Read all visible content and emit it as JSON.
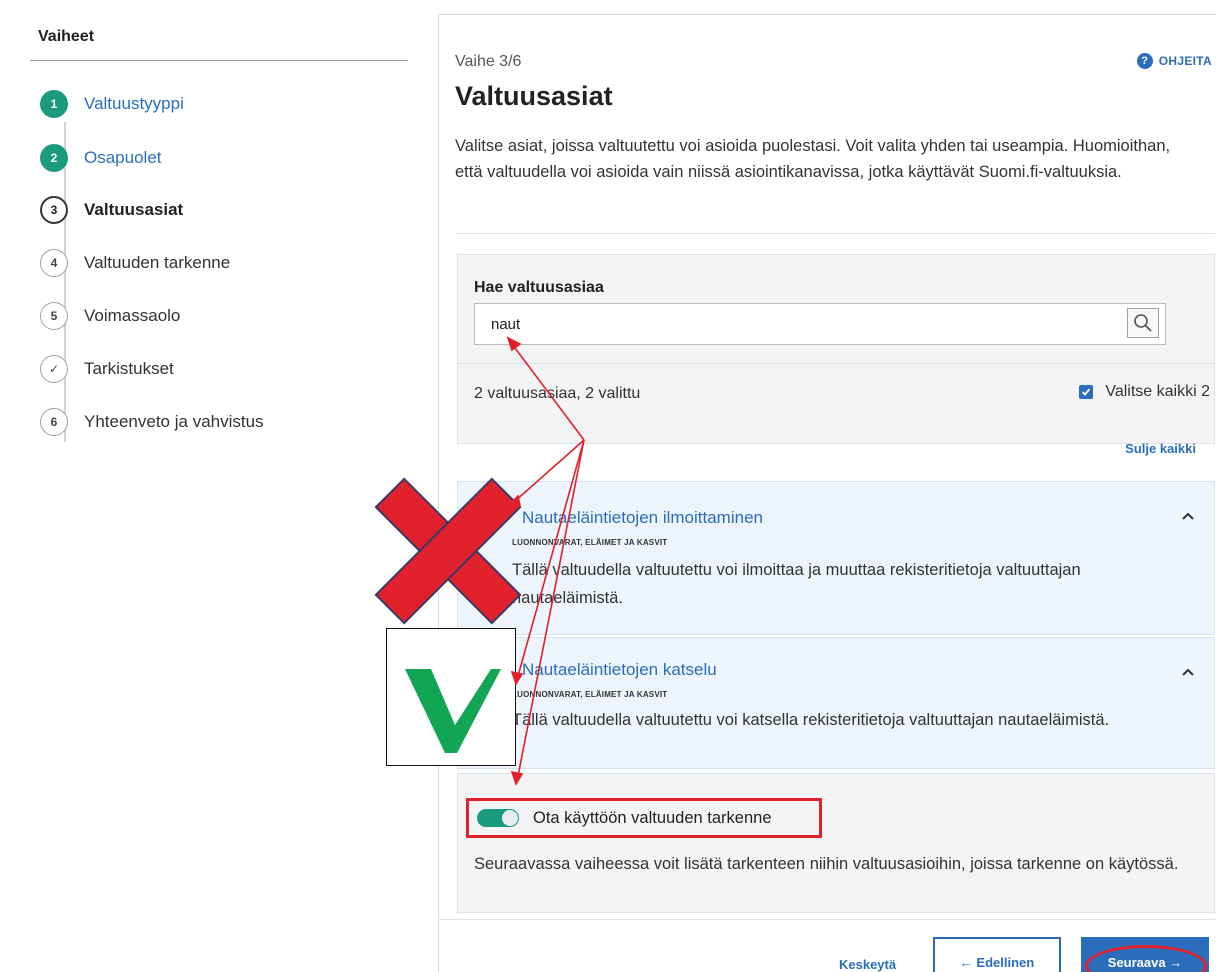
{
  "sidebar": {
    "title": "Vaiheet",
    "steps": [
      {
        "marker": "1",
        "label": "Valtuustyyppi",
        "state": "done"
      },
      {
        "marker": "2",
        "label": "Osapuolet",
        "state": "done"
      },
      {
        "marker": "3",
        "label": "Valtuusasiat",
        "state": "current"
      },
      {
        "marker": "4",
        "label": "Valtuuden tarkenne",
        "state": "pending"
      },
      {
        "marker": "5",
        "label": "Voimassaolo",
        "state": "pending"
      },
      {
        "marker": "✓",
        "label": "Tarkistukset",
        "state": "pending"
      },
      {
        "marker": "6",
        "label": "Yhteenveto ja vahvistus",
        "state": "pending"
      }
    ]
  },
  "main": {
    "phase": "Vaihe 3/6",
    "help_label": "OHJEITA",
    "title": "Valtuusasiat",
    "intro": "Valitse asiat, joissa valtuutettu voi asioida puolestasi. Voit valita yhden tai useampia. Huomioithan, että valtuudella voi asioida vain niissä asiointikanavissa, jotka käyttävät Suomi.fi-valtuuksia."
  },
  "search": {
    "label": "Hae valtuusasiaa",
    "value": "naut",
    "result_count": "2 valtuusasiaa, 2 valittu",
    "select_all": "Valitse kaikki 2",
    "select_all_checked": true
  },
  "close_all": "Sulje kaikki",
  "items": [
    {
      "title": "Nautaeläintietojen ilmoittaminen",
      "category": "LUONNONVARAT, ELÄIMET JA KASVIT",
      "description": "Tällä valtuudella valtuutettu voi ilmoittaa ja muuttaa rekisteritietoja valtuuttajan nautaeläimistä."
    },
    {
      "title": "Nautaeläintietojen katselu",
      "category": "LUONNONVARAT, ELÄIMET JA KASVIT",
      "description": "Tällä valtuudella valtuutettu voi katsella rekisteritietoja valtuuttajan nautaeläimistä."
    }
  ],
  "toggle": {
    "label": "Ota käyttöön valtuuden tarkenne",
    "enabled": true,
    "description": "Seuraavassa vaiheessa voit lisätä tarkenteen niihin valtuusasioihin, joissa tarkenne on käytössä."
  },
  "footer": {
    "cancel": "Keskeytä",
    "previous": "← Edellinen",
    "next": "Seuraava →"
  },
  "colors": {
    "accent_blue": "#2a6ebb",
    "done_green": "#1a9b7e",
    "annotation_red": "#e0202a",
    "check_green": "#12a553"
  }
}
